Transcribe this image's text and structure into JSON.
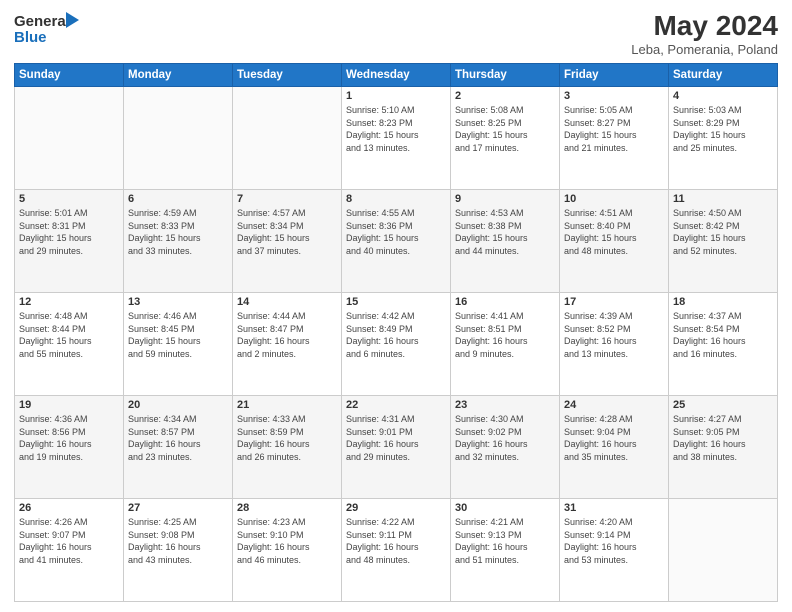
{
  "header": {
    "logo_line1": "General",
    "logo_line2": "Blue",
    "title": "May 2024",
    "subtitle": "Leba, Pomerania, Poland"
  },
  "weekdays": [
    "Sunday",
    "Monday",
    "Tuesday",
    "Wednesday",
    "Thursday",
    "Friday",
    "Saturday"
  ],
  "weeks": [
    [
      {
        "day": "",
        "info": ""
      },
      {
        "day": "",
        "info": ""
      },
      {
        "day": "",
        "info": ""
      },
      {
        "day": "1",
        "info": "Sunrise: 5:10 AM\nSunset: 8:23 PM\nDaylight: 15 hours\nand 13 minutes."
      },
      {
        "day": "2",
        "info": "Sunrise: 5:08 AM\nSunset: 8:25 PM\nDaylight: 15 hours\nand 17 minutes."
      },
      {
        "day": "3",
        "info": "Sunrise: 5:05 AM\nSunset: 8:27 PM\nDaylight: 15 hours\nand 21 minutes."
      },
      {
        "day": "4",
        "info": "Sunrise: 5:03 AM\nSunset: 8:29 PM\nDaylight: 15 hours\nand 25 minutes."
      }
    ],
    [
      {
        "day": "5",
        "info": "Sunrise: 5:01 AM\nSunset: 8:31 PM\nDaylight: 15 hours\nand 29 minutes."
      },
      {
        "day": "6",
        "info": "Sunrise: 4:59 AM\nSunset: 8:33 PM\nDaylight: 15 hours\nand 33 minutes."
      },
      {
        "day": "7",
        "info": "Sunrise: 4:57 AM\nSunset: 8:34 PM\nDaylight: 15 hours\nand 37 minutes."
      },
      {
        "day": "8",
        "info": "Sunrise: 4:55 AM\nSunset: 8:36 PM\nDaylight: 15 hours\nand 40 minutes."
      },
      {
        "day": "9",
        "info": "Sunrise: 4:53 AM\nSunset: 8:38 PM\nDaylight: 15 hours\nand 44 minutes."
      },
      {
        "day": "10",
        "info": "Sunrise: 4:51 AM\nSunset: 8:40 PM\nDaylight: 15 hours\nand 48 minutes."
      },
      {
        "day": "11",
        "info": "Sunrise: 4:50 AM\nSunset: 8:42 PM\nDaylight: 15 hours\nand 52 minutes."
      }
    ],
    [
      {
        "day": "12",
        "info": "Sunrise: 4:48 AM\nSunset: 8:44 PM\nDaylight: 15 hours\nand 55 minutes."
      },
      {
        "day": "13",
        "info": "Sunrise: 4:46 AM\nSunset: 8:45 PM\nDaylight: 15 hours\nand 59 minutes."
      },
      {
        "day": "14",
        "info": "Sunrise: 4:44 AM\nSunset: 8:47 PM\nDaylight: 16 hours\nand 2 minutes."
      },
      {
        "day": "15",
        "info": "Sunrise: 4:42 AM\nSunset: 8:49 PM\nDaylight: 16 hours\nand 6 minutes."
      },
      {
        "day": "16",
        "info": "Sunrise: 4:41 AM\nSunset: 8:51 PM\nDaylight: 16 hours\nand 9 minutes."
      },
      {
        "day": "17",
        "info": "Sunrise: 4:39 AM\nSunset: 8:52 PM\nDaylight: 16 hours\nand 13 minutes."
      },
      {
        "day": "18",
        "info": "Sunrise: 4:37 AM\nSunset: 8:54 PM\nDaylight: 16 hours\nand 16 minutes."
      }
    ],
    [
      {
        "day": "19",
        "info": "Sunrise: 4:36 AM\nSunset: 8:56 PM\nDaylight: 16 hours\nand 19 minutes."
      },
      {
        "day": "20",
        "info": "Sunrise: 4:34 AM\nSunset: 8:57 PM\nDaylight: 16 hours\nand 23 minutes."
      },
      {
        "day": "21",
        "info": "Sunrise: 4:33 AM\nSunset: 8:59 PM\nDaylight: 16 hours\nand 26 minutes."
      },
      {
        "day": "22",
        "info": "Sunrise: 4:31 AM\nSunset: 9:01 PM\nDaylight: 16 hours\nand 29 minutes."
      },
      {
        "day": "23",
        "info": "Sunrise: 4:30 AM\nSunset: 9:02 PM\nDaylight: 16 hours\nand 32 minutes."
      },
      {
        "day": "24",
        "info": "Sunrise: 4:28 AM\nSunset: 9:04 PM\nDaylight: 16 hours\nand 35 minutes."
      },
      {
        "day": "25",
        "info": "Sunrise: 4:27 AM\nSunset: 9:05 PM\nDaylight: 16 hours\nand 38 minutes."
      }
    ],
    [
      {
        "day": "26",
        "info": "Sunrise: 4:26 AM\nSunset: 9:07 PM\nDaylight: 16 hours\nand 41 minutes."
      },
      {
        "day": "27",
        "info": "Sunrise: 4:25 AM\nSunset: 9:08 PM\nDaylight: 16 hours\nand 43 minutes."
      },
      {
        "day": "28",
        "info": "Sunrise: 4:23 AM\nSunset: 9:10 PM\nDaylight: 16 hours\nand 46 minutes."
      },
      {
        "day": "29",
        "info": "Sunrise: 4:22 AM\nSunset: 9:11 PM\nDaylight: 16 hours\nand 48 minutes."
      },
      {
        "day": "30",
        "info": "Sunrise: 4:21 AM\nSunset: 9:13 PM\nDaylight: 16 hours\nand 51 minutes."
      },
      {
        "day": "31",
        "info": "Sunrise: 4:20 AM\nSunset: 9:14 PM\nDaylight: 16 hours\nand 53 minutes."
      },
      {
        "day": "",
        "info": ""
      }
    ]
  ]
}
